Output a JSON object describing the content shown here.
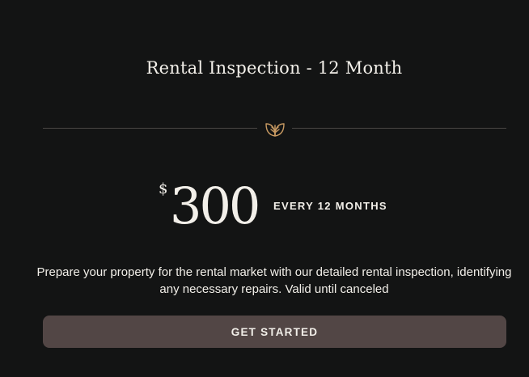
{
  "plan": {
    "title": "Rental Inspection - 12 Month",
    "currency_symbol": "$",
    "price": "300",
    "period": "EVERY 12 MONTHS",
    "description": "Prepare your property for the rental market with our detailed rental inspection, identifying any necessary repairs. Valid until canceled",
    "cta_label": "GET STARTED"
  },
  "icons": {
    "divider_icon": "leaf-icon"
  },
  "colors": {
    "background": "#131414",
    "text": "#f2efe9",
    "accent_gold": "#c89a62",
    "button_bg": "#524645",
    "divider_line": "#4a4745"
  }
}
